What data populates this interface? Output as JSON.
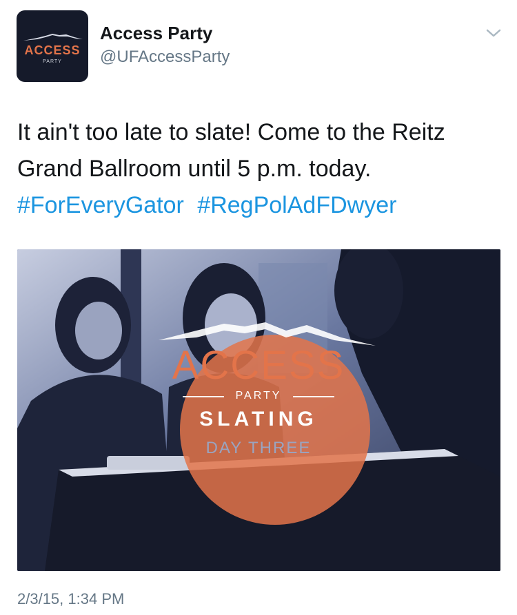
{
  "author": {
    "name": "Access Party",
    "handle": "@UFAccessParty",
    "avatar_brand": "ACCESS",
    "avatar_sub": "PARTY"
  },
  "tweet": {
    "text": "It ain't too late to slate! Come to the Reitz Grand Ballroom until 5 p.m. today.",
    "hashtags": [
      "#ForEveryGator",
      "#RegPolAdFDwyer"
    ],
    "timestamp": "2/3/15, 1:34 PM"
  },
  "media": {
    "overlay_title": "ACCESS",
    "overlay_party": "PARTY",
    "overlay_slating": "SLATING",
    "overlay_day": "DAY THREE"
  },
  "icons": {
    "menu": "chevron-down-icon"
  },
  "colors": {
    "brand_orange": "#e3744a",
    "link_blue": "#1b95e0",
    "photo_tint": "#4a5a82",
    "secondary_text": "#657786"
  }
}
